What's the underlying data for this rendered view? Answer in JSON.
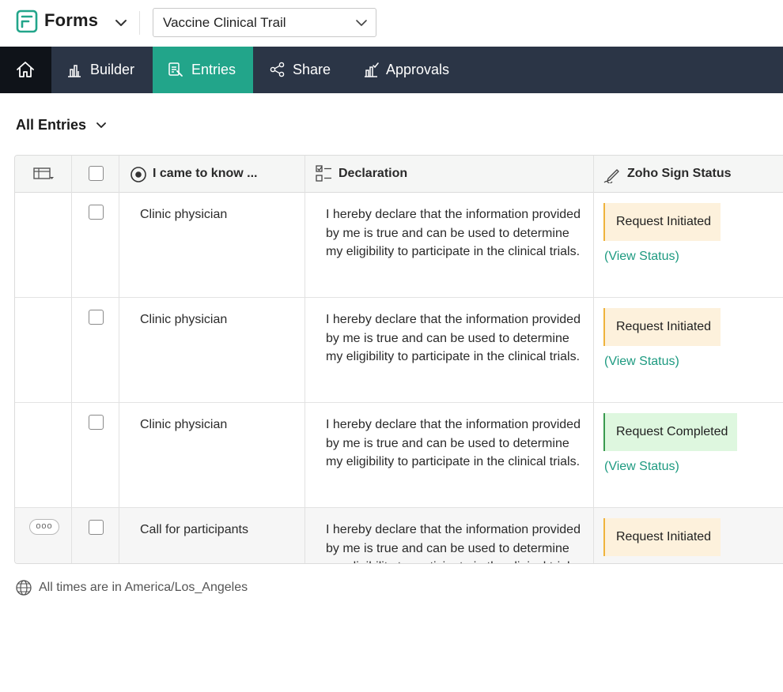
{
  "app": {
    "name": "Forms",
    "selected_form": "Vaccine Clinical Trail"
  },
  "nav": {
    "items": [
      {
        "label": "Builder"
      },
      {
        "label": "Entries"
      },
      {
        "label": "Share"
      },
      {
        "label": "Approvals"
      }
    ],
    "active": "Entries"
  },
  "view": {
    "title": "All Entries"
  },
  "table": {
    "columns": [
      {
        "label": "I came to know ..."
      },
      {
        "label": "Declaration"
      },
      {
        "label": "Zoho Sign Status"
      }
    ],
    "rows": [
      {
        "source": "Clinic physician",
        "declaration": "I hereby declare that the information provided by me is true and can be used to determine my eligibility to participate in the clinical trials.",
        "status": "Request Initiated",
        "status_color": "#efb33c",
        "link": "(View Status)"
      },
      {
        "source": "Clinic physician",
        "declaration": "I hereby declare that the information provided by me is true and can be used to determine my eligibility to participate in the clinical trials.",
        "status": "Request Initiated",
        "status_color": "#efb33c",
        "link": "(View Status)"
      },
      {
        "source": "Clinic physician",
        "declaration": "I hereby declare that the information provided by me is true and can be used to determine my eligibility to participate in the clinical trials.",
        "status": "Request Completed",
        "status_color": "#3a9a4f",
        "link": "(View Status)"
      },
      {
        "source": "Call for participants",
        "declaration": "I hereby declare that the information provided by me is true and can be used to determine my eligibility to participate in the clinical trials.",
        "status": "Request Initiated",
        "status_color": "#efb33c",
        "more_label": "ooo"
      }
    ]
  },
  "footer": {
    "timezone_text": "All times are in America/Los_Angeles"
  },
  "colors": {
    "nav_bg": "#2b3546",
    "nav_active": "#22a58a",
    "link": "#1d9a80",
    "brand_green": "#22a58a"
  }
}
